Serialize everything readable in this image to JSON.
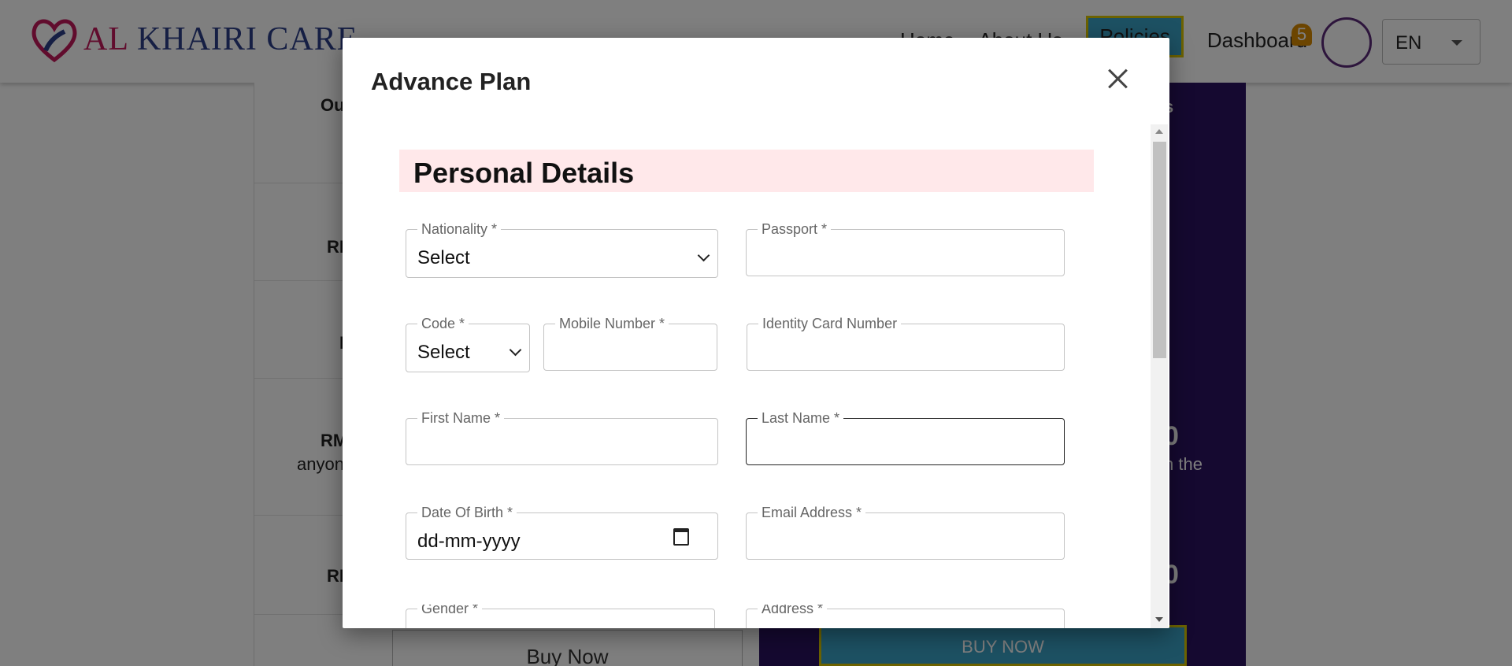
{
  "nav": {
    "brand_prefix": "AL",
    "brand_main": "KHAIRI CARE",
    "links": [
      "Home",
      "About Us",
      "Policies",
      "Dashboard"
    ],
    "notification_count": "5",
    "language": "EN"
  },
  "background": {
    "table_fragments": [
      "Ou",
      "RI",
      "R",
      "RM",
      "anyon",
      "RI"
    ],
    "dark_fragments": [
      "s",
      "0",
      "0",
      "n the"
    ],
    "buy_now_left": "Buy Now",
    "buy_now_right": "BUY NOW"
  },
  "modal": {
    "title": "Advance Plan",
    "section_title": "Personal Details",
    "fields": {
      "nationality": {
        "label": "Nationality *",
        "value": "Select"
      },
      "passport": {
        "label": "Passport *",
        "value": ""
      },
      "code": {
        "label": "Code *",
        "value": "Select"
      },
      "mobile": {
        "label": "Mobile Number *",
        "value": ""
      },
      "identity_card": {
        "label": "Identity Card Number",
        "value": ""
      },
      "first_name": {
        "label": "First Name *",
        "value": ""
      },
      "last_name": {
        "label": "Last Name *",
        "value": ""
      },
      "dob": {
        "label": "Date Of Birth *",
        "value": "dd-mm-yyyy"
      },
      "email": {
        "label": "Email Address *",
        "value": ""
      },
      "gender": {
        "label": "Gender *",
        "value": ""
      },
      "address": {
        "label": "Address *",
        "value": ""
      }
    }
  },
  "colors": {
    "section_header_bg": "#ffe8ea",
    "dark_panel": "#2b1260",
    "accent_button": "#3ba3c6",
    "accent_border": "#d9c400"
  }
}
